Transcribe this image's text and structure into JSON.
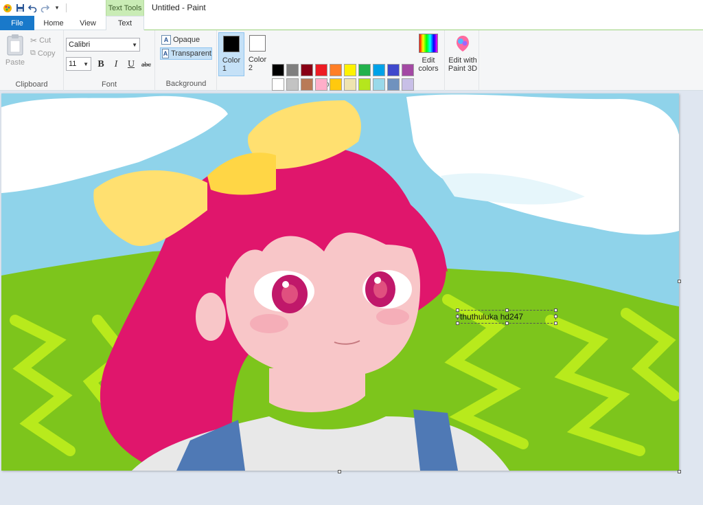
{
  "window": {
    "title": "Untitled - Paint",
    "context_tab": "Text Tools"
  },
  "qat": {
    "items": [
      "paint-app-icon",
      "save-icon",
      "undo-icon",
      "redo-icon",
      "customize-icon"
    ]
  },
  "tabs": {
    "file": "File",
    "home": "Home",
    "view": "View",
    "text": "Text"
  },
  "clipboard": {
    "paste": "Paste",
    "cut": "Cut",
    "copy": "Copy",
    "label": "Clipboard"
  },
  "font": {
    "family": "Calibri",
    "size": "11",
    "bold": "B",
    "italic": "I",
    "underline": "U",
    "strike": "abc",
    "label": "Font"
  },
  "background": {
    "opaque": "Opaque",
    "transparent": "Transparent",
    "label": "Background",
    "selected": "transparent"
  },
  "colors": {
    "color1_label": "Color\n1",
    "color2_label": "Color\n2",
    "color1": "#000000",
    "color2": "#ffffff",
    "edit_colors": "Edit colors",
    "edit_paint3d": "Edit with Paint 3D",
    "label": "Colors",
    "palette": [
      "#000000",
      "#7f7f7f",
      "#880015",
      "#ed1c24",
      "#ff7f27",
      "#fff200",
      "#22b14c",
      "#00a2e8",
      "#3f48cc",
      "#a349a4",
      "#ffffff",
      "#c3c3c3",
      "#b97a57",
      "#ffaec9",
      "#ffc90e",
      "#efe4b0",
      "#b5e61d",
      "#99d9ea",
      "#7092be",
      "#c8bfe7",
      "#d81b60",
      "#c2185b",
      "#d42a7a",
      "#ffd35c",
      "#f7a6b5",
      "#e8e8e8",
      "#4f79b5",
      "#41679e",
      "#e0e0e0",
      "#8cc63f"
    ]
  },
  "canvas": {
    "text_entry": "thuthuluka hd247"
  }
}
